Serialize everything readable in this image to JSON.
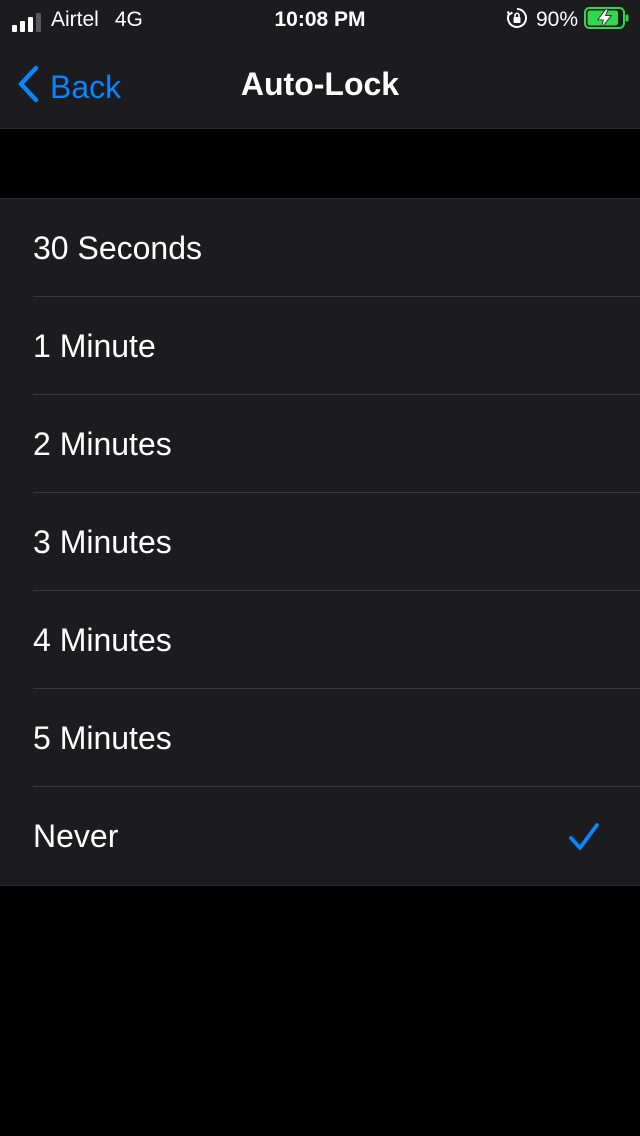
{
  "status_bar": {
    "carrier": "Airtel",
    "network": "4G",
    "time": "10:08 PM",
    "battery_percent": "90%",
    "battery_level": 0.9,
    "signal_bars": 3,
    "battery_color": "#32d74b",
    "orientation_lock_icon": "orientation-lock-icon"
  },
  "nav": {
    "back_label": "Back",
    "title": "Auto-Lock",
    "accent": "#0a84ff"
  },
  "options": [
    {
      "label": "30 Seconds",
      "selected": false
    },
    {
      "label": "1 Minute",
      "selected": false
    },
    {
      "label": "2 Minutes",
      "selected": false
    },
    {
      "label": "3 Minutes",
      "selected": false
    },
    {
      "label": "4 Minutes",
      "selected": false
    },
    {
      "label": "5 Minutes",
      "selected": false
    },
    {
      "label": "Never",
      "selected": true
    }
  ]
}
